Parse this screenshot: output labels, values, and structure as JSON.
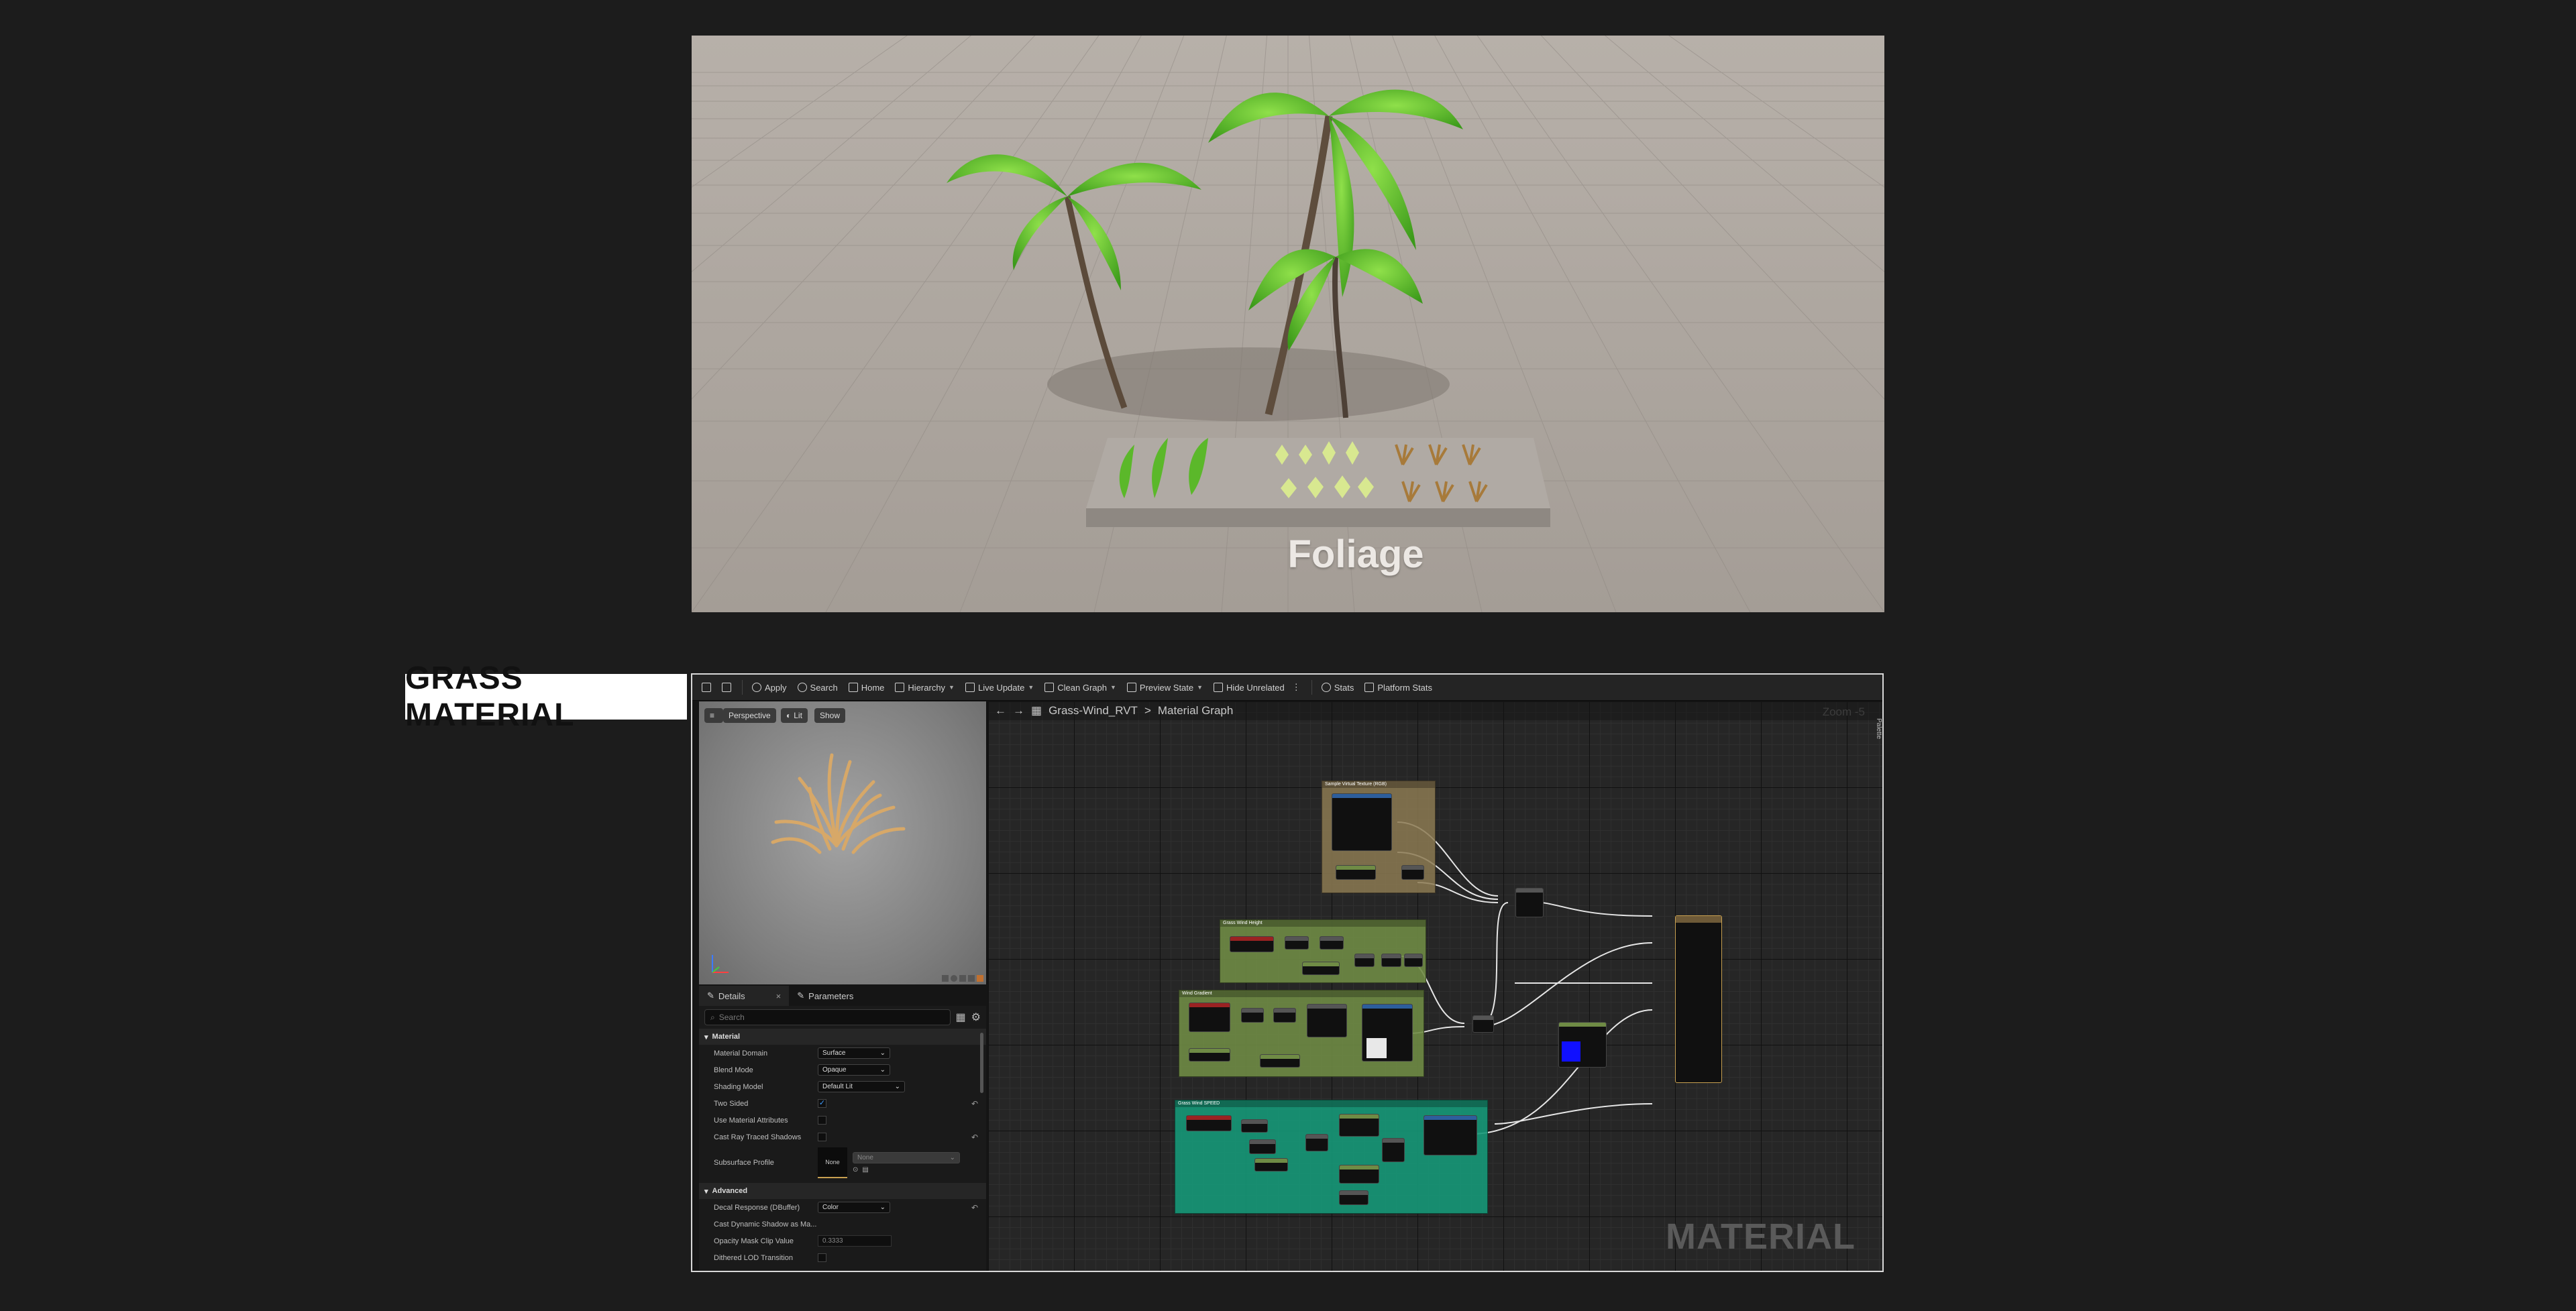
{
  "viewport": {
    "label": "Foliage"
  },
  "section_tag": "GRASS MATERIAL",
  "toolbar": {
    "items": [
      {
        "label": "Apply",
        "icon": "apply-icon"
      },
      {
        "label": "Search",
        "icon": "search-icon"
      },
      {
        "label": "Home",
        "icon": "home-icon"
      },
      {
        "label": "Hierarchy",
        "icon": "hierarchy-icon",
        "dropdown": true
      },
      {
        "label": "Live Update",
        "icon": "live-update-icon",
        "dropdown": true
      },
      {
        "label": "Clean Graph",
        "icon": "clean-graph-icon",
        "dropdown": true
      },
      {
        "label": "Preview State",
        "icon": "preview-state-icon",
        "dropdown": true
      },
      {
        "label": "Hide Unrelated",
        "icon": "hide-unrelated-icon"
      },
      {
        "label": "Stats",
        "icon": "stats-icon"
      },
      {
        "label": "Platform Stats",
        "icon": "platform-stats-icon"
      }
    ]
  },
  "preview": {
    "perspective": "Perspective",
    "lit": "Lit",
    "show": "Show"
  },
  "details": {
    "tab_details": "Details",
    "tab_parameters": "Parameters",
    "search_placeholder": "Search",
    "material_header": "Material",
    "advanced_header": "Advanced",
    "properties": {
      "material_domain": {
        "label": "Material Domain",
        "value": "Surface"
      },
      "blend_mode": {
        "label": "Blend Mode",
        "value": "Opaque"
      },
      "shading_model": {
        "label": "Shading Model",
        "value": "Default Lit"
      },
      "two_sided": {
        "label": "Two Sided",
        "checked": true
      },
      "use_material_attributes": {
        "label": "Use Material Attributes",
        "checked": false
      },
      "cast_ray_traced_shadows": {
        "label": "Cast Ray Traced Shadows",
        "checked": false
      },
      "subsurface_profile": {
        "label": "Subsurface Profile",
        "thumb": "None",
        "value": "None"
      },
      "decal_response": {
        "label": "Decal Response (DBuffer)",
        "value": "Color"
      },
      "cast_dynamic_shadow": {
        "label": "Cast Dynamic Shadow as Ma..."
      },
      "opacity_mask_clip": {
        "label": "Opacity Mask Clip Value",
        "value": "0.3333"
      },
      "dithered_lod": {
        "label": "Dithered LOD Transition",
        "checked": false
      }
    }
  },
  "graph": {
    "breadcrumb_asset": "Grass-Wind_RVT",
    "breadcrumb_sep": ">",
    "breadcrumb_graph": "Material Graph",
    "zoom": "Zoom -5",
    "palette": "Palette",
    "watermark": "MATERIAL",
    "comments": [
      {
        "title": "Sample Virtual Texture (RGB)",
        "color": "#8c7a52"
      },
      {
        "title": "Grass Wind Height",
        "color": "#6f8b45"
      },
      {
        "title": "Wind Gradient",
        "color": "#6f8b45"
      },
      {
        "title": "Grass Wind SPEED",
        "color": "#169878"
      }
    ]
  }
}
